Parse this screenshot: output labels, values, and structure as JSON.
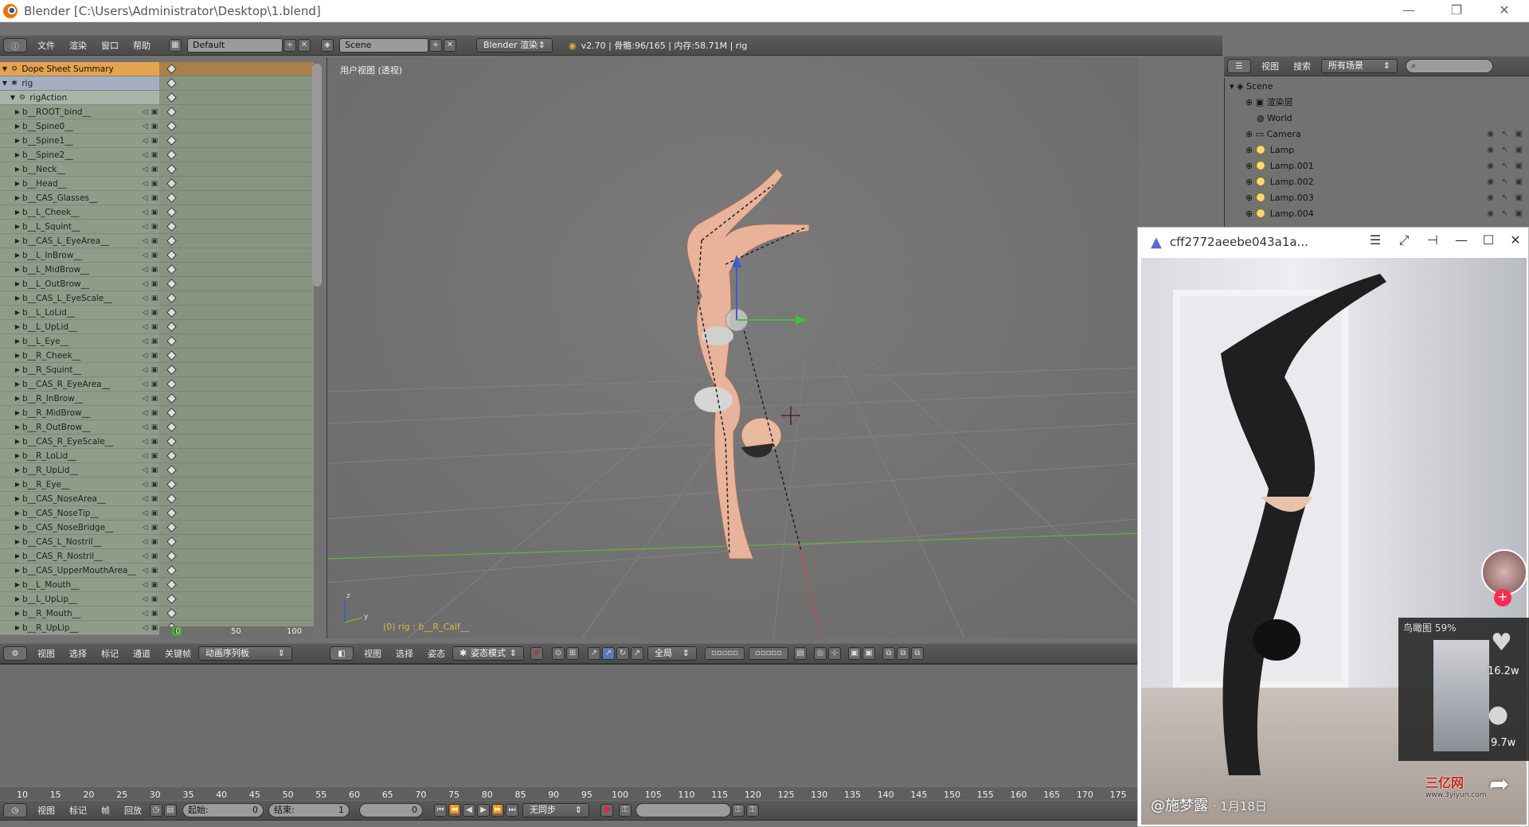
{
  "window": {
    "title": "Blender [C:\\Users\\Administrator\\Desktop\\1.blend]",
    "minimize": "—",
    "restore": "❐",
    "close": "✕"
  },
  "top_header": {
    "menus": [
      "文件",
      "渲染",
      "窗口",
      "帮助"
    ],
    "layout_value": "Default",
    "scene_value": "Scene",
    "engine_value": "Blender 渲染",
    "info": "v2.70 | 骨骼:96/165 | 内存:58.71M | rig"
  },
  "outliner_header": {
    "menus": [
      "视图",
      "搜索"
    ],
    "filter_value": "所有场景"
  },
  "outliner": {
    "items": [
      {
        "label": "Scene",
        "indent": 0
      },
      {
        "label": "渲染层",
        "indent": 1
      },
      {
        "label": "World",
        "indent": 1
      },
      {
        "label": "Camera",
        "indent": 1
      },
      {
        "label": "Lamp",
        "indent": 1
      },
      {
        "label": "Lamp.001",
        "indent": 1
      },
      {
        "label": "Lamp.002",
        "indent": 1
      },
      {
        "label": "Lamp.003",
        "indent": 1
      },
      {
        "label": "Lamp.004",
        "indent": 1
      }
    ]
  },
  "dopesheet": {
    "summary": "Dope Sheet Summary",
    "object": "rig",
    "action": "rigAction",
    "channels": [
      "b__ROOT_bind__",
      "b__Spine0__",
      "b__Spine1__",
      "b__Spine2__",
      "b__Neck__",
      "b__Head__",
      "b__CAS_Glasses__",
      "b__L_Cheek__",
      "b__L_Squint__",
      "b__CAS_L_EyeArea__",
      "b__L_InBrow__",
      "b__L_MidBrow__",
      "b__L_OutBrow__",
      "b__CAS_L_EyeScale__",
      "b__L_LoLid__",
      "b__L_UpLid__",
      "b__L_Eye__",
      "b__R_Cheek__",
      "b__R_Squint__",
      "b__CAS_R_EyeArea__",
      "b__R_InBrow__",
      "b__R_MidBrow__",
      "b__R_OutBrow__",
      "b__CAS_R_EyeScale__",
      "b__R_LoLid__",
      "b__R_UpLid__",
      "b__R_Eye__",
      "b__CAS_NoseArea__",
      "b__CAS_NoseTip__",
      "b__CAS_NoseBridge__",
      "b__CAS_L_Nostril__",
      "b__CAS_R_Nostril__",
      "b__CAS_UpperMouthArea__",
      "b__L_Mouth__",
      "b__L_UpLip__",
      "b__R_Mouth__",
      "b__R_UpLip__"
    ],
    "ruler": [
      "0",
      "50",
      "100"
    ],
    "current_frame": "0"
  },
  "dopesheet_header": {
    "menus": [
      "视图",
      "选择",
      "标记",
      "通道",
      "关键帧"
    ],
    "mode_value": "动画序列板"
  },
  "viewport": {
    "label": "用户视图 (透视)",
    "status": "(0) rig : b__R_Calf__",
    "axis_z": "z",
    "axis_y": "y"
  },
  "viewport_header": {
    "menus": [
      "视图",
      "选择",
      "姿态"
    ],
    "mode_value": "姿态模式",
    "pivot_value": "全局"
  },
  "timeline": {
    "ticks": [
      "10",
      "15",
      "20",
      "25",
      "30",
      "35",
      "40",
      "45",
      "50",
      "55",
      "60",
      "65",
      "70",
      "75",
      "80",
      "85",
      "90",
      "95",
      "100",
      "105",
      "110",
      "115",
      "120",
      "125",
      "130",
      "135",
      "140",
      "145",
      "150",
      "155",
      "160",
      "165",
      "170",
      "175"
    ]
  },
  "timeline_header": {
    "menus": [
      "视图",
      "标记",
      "帧",
      "回放"
    ],
    "start_label": "起始:",
    "start_value": "0",
    "end_label": "结束:",
    "end_value": "1",
    "current_value": "0",
    "sync_value": "无同步"
  },
  "player": {
    "title": "cff2772aeebe043a1a...",
    "author": "@施梦露",
    "date": "· 1月18日",
    "minimap_label": "鸟瞰图 59%",
    "likes": "16.2w",
    "comments": "9.7w"
  },
  "watermark": {
    "text": "三亿网",
    "url": "www.3yiyun.com"
  },
  "colors": {
    "summary": "#e4a34e",
    "channel_bg": "#8e9c8a",
    "keyframe": "#dddddd",
    "viewport_bg": "#727272",
    "header_bg": "#4e4e4e",
    "axis_x": "#d04848",
    "axis_y": "#62b33c",
    "axis_z": "#3f5bd0"
  }
}
